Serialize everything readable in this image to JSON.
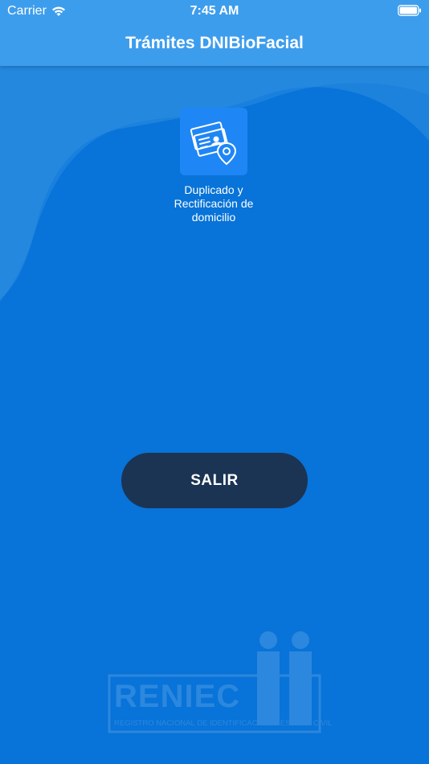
{
  "status_bar": {
    "carrier": "Carrier",
    "time": "7:45 AM"
  },
  "header": {
    "title": "Trámites DNIBioFacial"
  },
  "tiles": [
    {
      "label": "Duplicado y Rectificación de domicilio",
      "icon": "id-card-location-icon"
    }
  ],
  "actions": {
    "exit_label": "SALIR"
  },
  "logo": {
    "name": "RENIEC",
    "subtitle": "REGISTRO NACIONAL DE IDENTIFICACIÓN Y ESTADO CIVIL"
  },
  "colors": {
    "background": "#0873d8",
    "header": "#3d9ded",
    "tile": "#1f86f5",
    "button": "#1b3453"
  }
}
